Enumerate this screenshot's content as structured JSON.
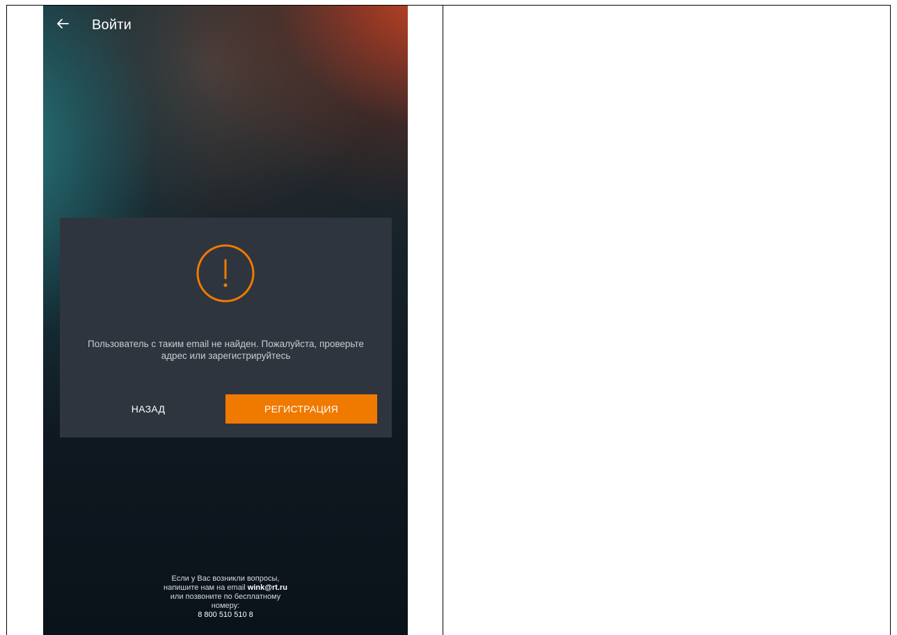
{
  "topbar": {
    "back_icon": "arrow-left-icon",
    "title": "Войти"
  },
  "dialog": {
    "icon": "warning-circle-icon",
    "accent_color": "#f07a00",
    "message": "Пользователь с таким email не найден. Пожалуйста, проверьте адрес или зарегистрируйтесь",
    "back_label": "НАЗАД",
    "register_label": "РЕГИСТРАЦИЯ"
  },
  "footer": {
    "line1": "Если у Вас возникли вопросы,",
    "line2_prefix": "напишите нам на email ",
    "email": "wink@rt.ru",
    "line3": "или позвоните по бесплатному",
    "line4": "номеру:",
    "phone": "8 800 510 510 8"
  }
}
